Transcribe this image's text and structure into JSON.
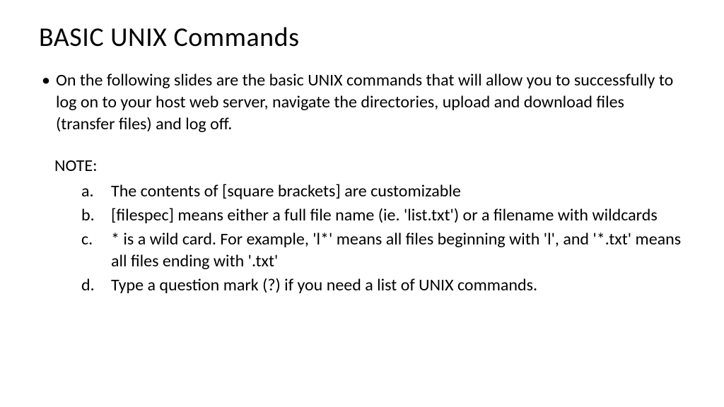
{
  "title": "BASIC UNIX Commands",
  "bullet": {
    "text": "On the following slides are the basic UNIX commands that will allow you to successfully to log on to your host web server, navigate the directories, upload and download files (transfer files) and log off."
  },
  "note": {
    "label": "NOTE:",
    "items": [
      "The contents of [square brackets] are customizable",
      "[filespec] means either a full file name (ie. 'list.txt') or a filename with wildcards",
      "* is a wild card. For example, 'l*' means all files beginning with 'l', and '*.txt' means all files ending with '.txt'",
      "Type a question mark (?) if you need a list of UNIX commands."
    ]
  }
}
